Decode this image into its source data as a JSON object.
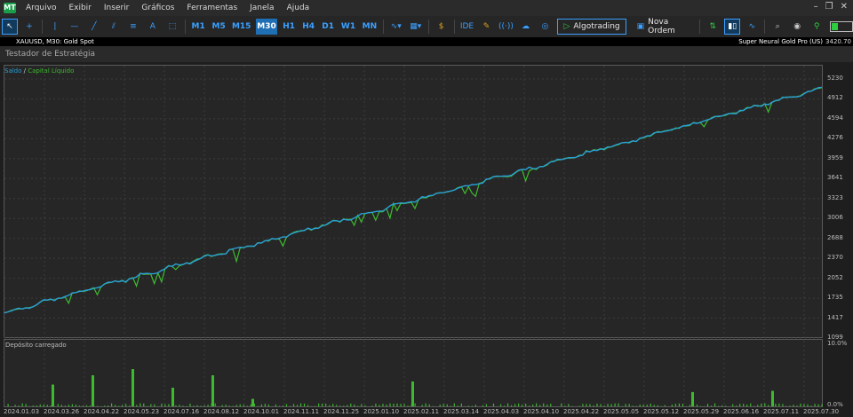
{
  "menu": [
    "Arquivo",
    "Exibir",
    "Inserir",
    "Gráficos",
    "Ferramentas",
    "Janela",
    "Ajuda"
  ],
  "toolbar": {
    "timeframes": [
      "M1",
      "M5",
      "M15",
      "M30",
      "H1",
      "H4",
      "D1",
      "W1",
      "MN"
    ],
    "active_timeframe": "M30",
    "algotrading_label": "Algotrading",
    "new_order_label": "Nova Ordem",
    "ide_label": "IDE"
  },
  "symbol": {
    "name": "XAUUSD, M30:  Gold Spot",
    "ea": "Super Neural Gold Pro (US)",
    "price": "3420.70"
  },
  "panel_title": "Testador de Estratégia",
  "legend": {
    "balance": "Saldo",
    "divider": "/",
    "equity": "Capital Líquido"
  },
  "volume_title": "Depósito carregado",
  "colors": {
    "balance": "#2a9fd6",
    "equity": "#3dbb2e",
    "accent": "#3aa0ff"
  },
  "chart_data": {
    "type": "line",
    "series": [
      {
        "name": "Saldo",
        "start": 1500,
        "end": 5080
      },
      {
        "name": "Capital Líquido",
        "start": 1500,
        "end": 5080
      }
    ],
    "ylim": [
      1099,
      5230
    ],
    "y_ticks": [
      "5230",
      "4912",
      "4594",
      "4276",
      "3959",
      "3641",
      "3323",
      "3006",
      "2688",
      "2370",
      "2052",
      "1735",
      "1417",
      "1099"
    ],
    "x_ticks": [
      "2024.01.03",
      "2024.03.26",
      "2024.04.22",
      "2024.05.23",
      "2024.07.16",
      "2024.08.12",
      "2024.10.01",
      "2024.11.11",
      "2024.11.25",
      "2025.01.10",
      "2025.02.11",
      "2025.03.14",
      "2025.04.03",
      "2025.04.10",
      "2025.04.22",
      "2025.05.05",
      "2025.05.12",
      "2025.05.29",
      "2025.06.16",
      "2025.07.11",
      "2025.07.30"
    ],
    "load_ticks": [
      "10.0%",
      "0.0%"
    ],
    "load_spikes": [
      {
        "x": "2024.03.26",
        "value": 3.5
      },
      {
        "x": "2024.04.22",
        "value": 5.0
      },
      {
        "x": "2024.05.23",
        "value": 6.0
      },
      {
        "x": "2024.07.16",
        "value": 3.0
      },
      {
        "x": "2024.08.12",
        "value": 5.0
      },
      {
        "x": "2024.10.01",
        "value": 1.2
      },
      {
        "x": "2025.02.11",
        "value": 4.0
      },
      {
        "x": "2025.05.29",
        "value": 2.3
      },
      {
        "x": "2025.07.11",
        "value": 2.5
      }
    ]
  }
}
